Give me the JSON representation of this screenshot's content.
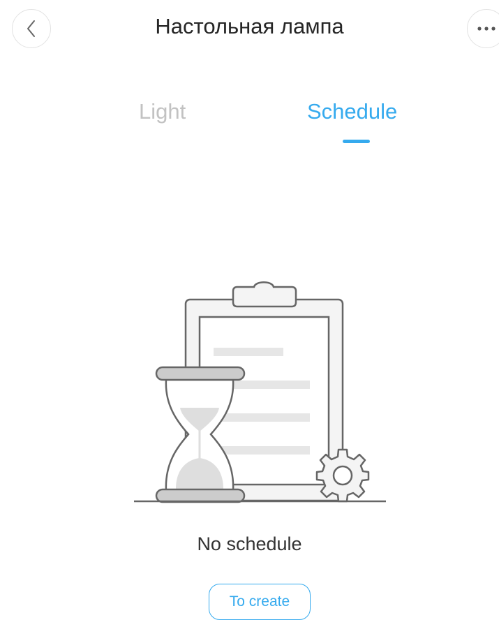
{
  "header": {
    "title": "Настольная лампа",
    "back_icon": "chevron-left-icon",
    "more_icon": "more-horizontal-icon"
  },
  "tabs": [
    {
      "label": "Light",
      "active": false
    },
    {
      "label": "Schedule",
      "active": true
    }
  ],
  "empty_state": {
    "illustration": "clipboard-hourglass-gear-illustration",
    "message": "No schedule",
    "create_label": "To create"
  },
  "colors": {
    "accent": "#35aaee",
    "inactive_tab": "#c2c2c2",
    "illustration_stroke": "#666666",
    "illustration_fill": "#f2f2f2"
  }
}
